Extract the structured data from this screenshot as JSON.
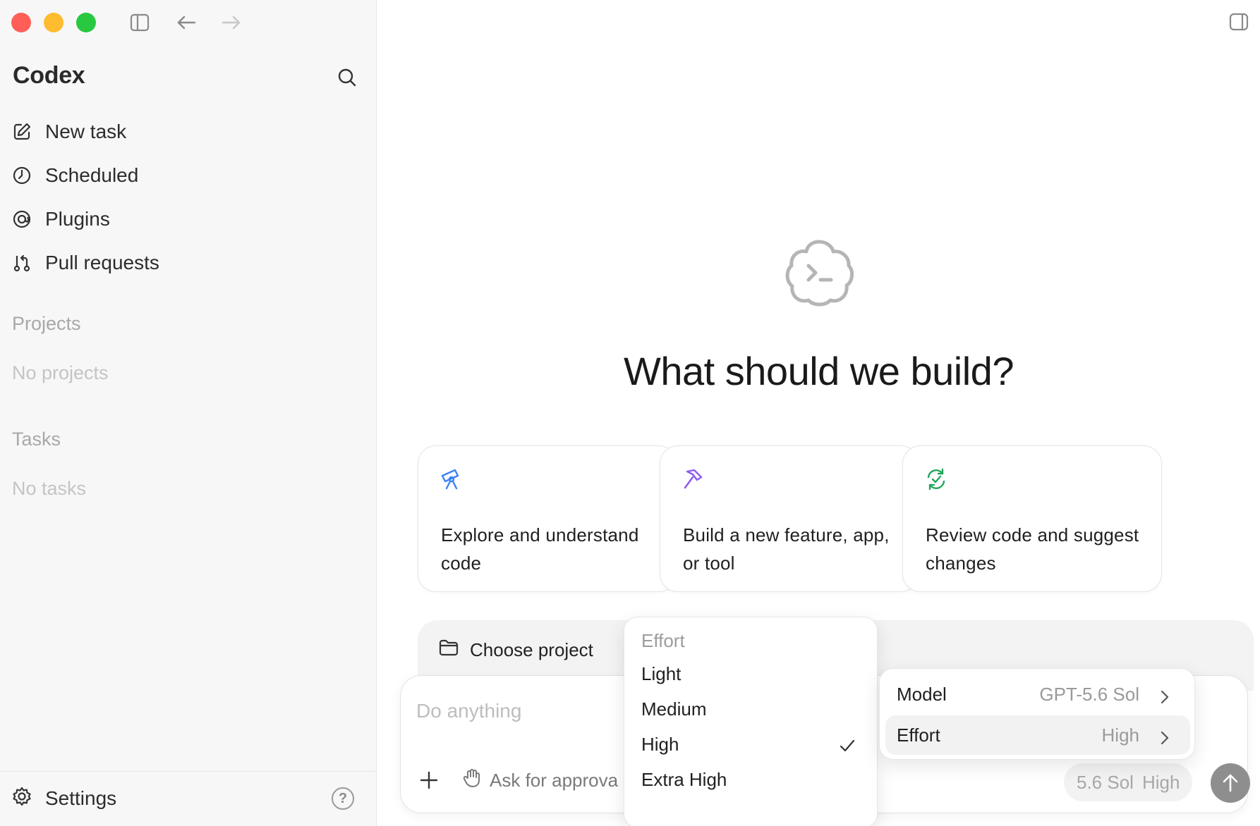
{
  "app": {
    "title": "Codex"
  },
  "window_controls": [
    "close",
    "minimize",
    "zoom"
  ],
  "toolbar": {
    "icons": [
      "sidebar-toggle-icon",
      "back-arrow-icon",
      "forward-arrow-icon",
      "panel-toggle-icon"
    ]
  },
  "sidebar": {
    "nav": [
      {
        "label": "New task",
        "icon": "edit-icon"
      },
      {
        "label": "Scheduled",
        "icon": "clock-icon"
      },
      {
        "label": "Plugins",
        "icon": "plugins-icon"
      },
      {
        "label": "Pull requests",
        "icon": "pull-request-icon"
      }
    ],
    "projects": {
      "heading": "Projects",
      "empty": "No projects"
    },
    "tasks": {
      "heading": "Tasks",
      "empty": "No tasks"
    },
    "footer": {
      "settings_label": "Settings",
      "help_symbol": "?"
    }
  },
  "main": {
    "headline": "What should we build?",
    "cards": [
      {
        "text": "Explore and understand code",
        "icon": "telescope-icon",
        "color": "#3b82f6"
      },
      {
        "text": "Build a new feature, app, or tool",
        "icon": "hammer-icon",
        "color": "#8b5cf6"
      },
      {
        "text": "Review code and suggest changes",
        "icon": "review-cycle-icon",
        "color": "#22a55b"
      }
    ],
    "project_selector": {
      "label": "Choose project"
    },
    "composer": {
      "placeholder": "Do anything",
      "approval_label": "Ask for approva",
      "model_pill": {
        "model": "5.6 Sol",
        "effort": "High"
      }
    }
  },
  "effort_menu": {
    "heading": "Effort",
    "options": [
      "Light",
      "Medium",
      "High",
      "Extra High"
    ],
    "selected": "High"
  },
  "settings_menu": {
    "rows": [
      {
        "label": "Model",
        "value": "GPT-5.6 Sol"
      },
      {
        "label": "Effort",
        "value": "High"
      }
    ]
  }
}
